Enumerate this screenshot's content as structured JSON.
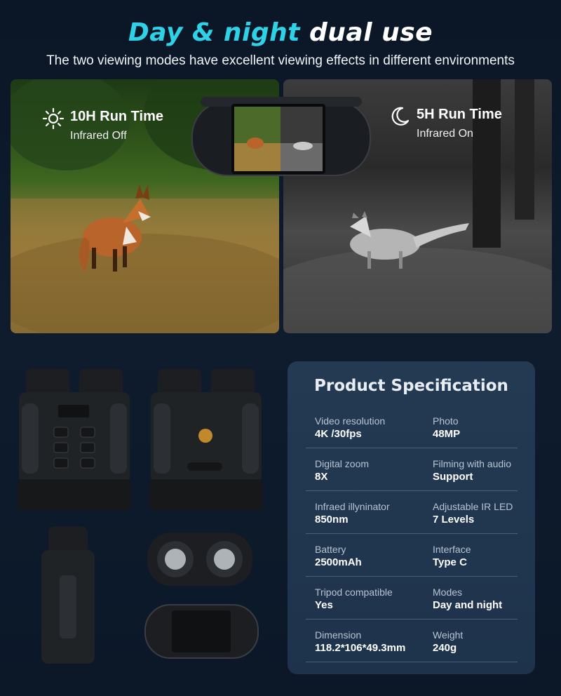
{
  "header": {
    "title_accent": "Day & night",
    "title_rest": "dual use",
    "subtitle": "The two viewing modes have excellent viewing effects in different environments"
  },
  "modes": {
    "day": {
      "icon": "sun-icon",
      "runtime": "10H Run Time",
      "infrared": "Infrared Off"
    },
    "night": {
      "icon": "moon-icon",
      "runtime": "5H Run Time",
      "infrared": "Infrared On"
    }
  },
  "spec": {
    "title": "Product Specification",
    "rows": [
      {
        "left_label": "Video resolution",
        "left_value": "4K /30fps",
        "right_label": "Photo",
        "right_value": "48MP"
      },
      {
        "left_label": "Digital zoom",
        "left_value": "8X",
        "right_label": "Filming with audio",
        "right_value": "Support"
      },
      {
        "left_label": "Infraed illyninator",
        "left_value": "850nm",
        "right_label": "Adjustable IR LED",
        "right_value": "7 Levels"
      },
      {
        "left_label": "Battery",
        "left_value": "2500mAh",
        "right_label": "Interface",
        "right_value": "Type C"
      },
      {
        "left_label": "Tripod compatible",
        "left_value": "Yes",
        "right_label": "Modes",
        "right_value": "Day and night"
      },
      {
        "left_label": "Dimension",
        "left_value": "118.2*106*49.3mm",
        "right_label": "Weight",
        "right_value": "240g"
      }
    ]
  },
  "colors": {
    "accent": "#2fd1e6",
    "background": "#0d1a2b",
    "card": "#243a53"
  }
}
